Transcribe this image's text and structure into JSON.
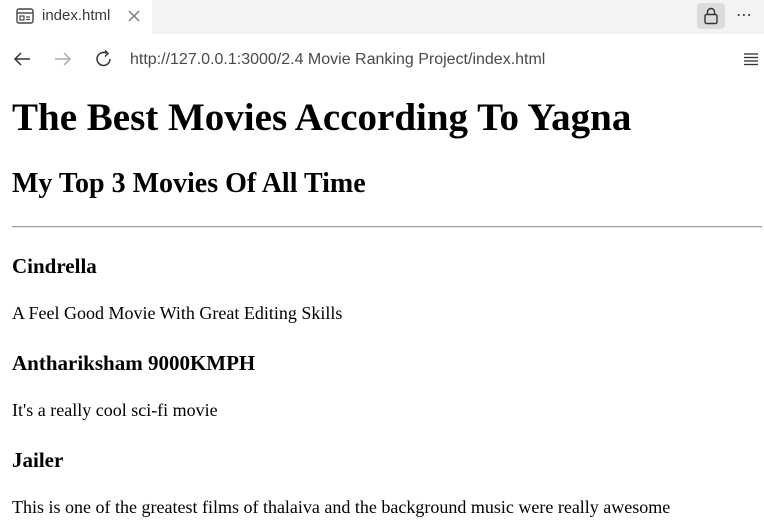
{
  "browser": {
    "tab": {
      "title": "index.html",
      "icon": "page-icon"
    },
    "address_bar": {
      "url": "http://127.0.0.1:3000/2.4 Movie Ranking Project/index.html"
    },
    "icons": {
      "back": "back-arrow-icon",
      "forward": "forward-arrow-icon",
      "reload": "reload-icon",
      "lock": "lock-icon",
      "more": "more-icon",
      "menu": "menu-icon"
    }
  },
  "page": {
    "title": "The Best Movies According To Yagna",
    "subtitle": "My Top 3 Movies Of All Time",
    "movies": [
      {
        "name": "Cindrella",
        "description": "A Feel Good Movie With Great Editing Skills"
      },
      {
        "name": "Anthariksham 9000KMPH",
        "description": "It's a really cool sci-fi movie"
      },
      {
        "name": "Jailer",
        "description": "This is one of the greatest films of thalaiva and the background music were really awesome"
      }
    ]
  }
}
